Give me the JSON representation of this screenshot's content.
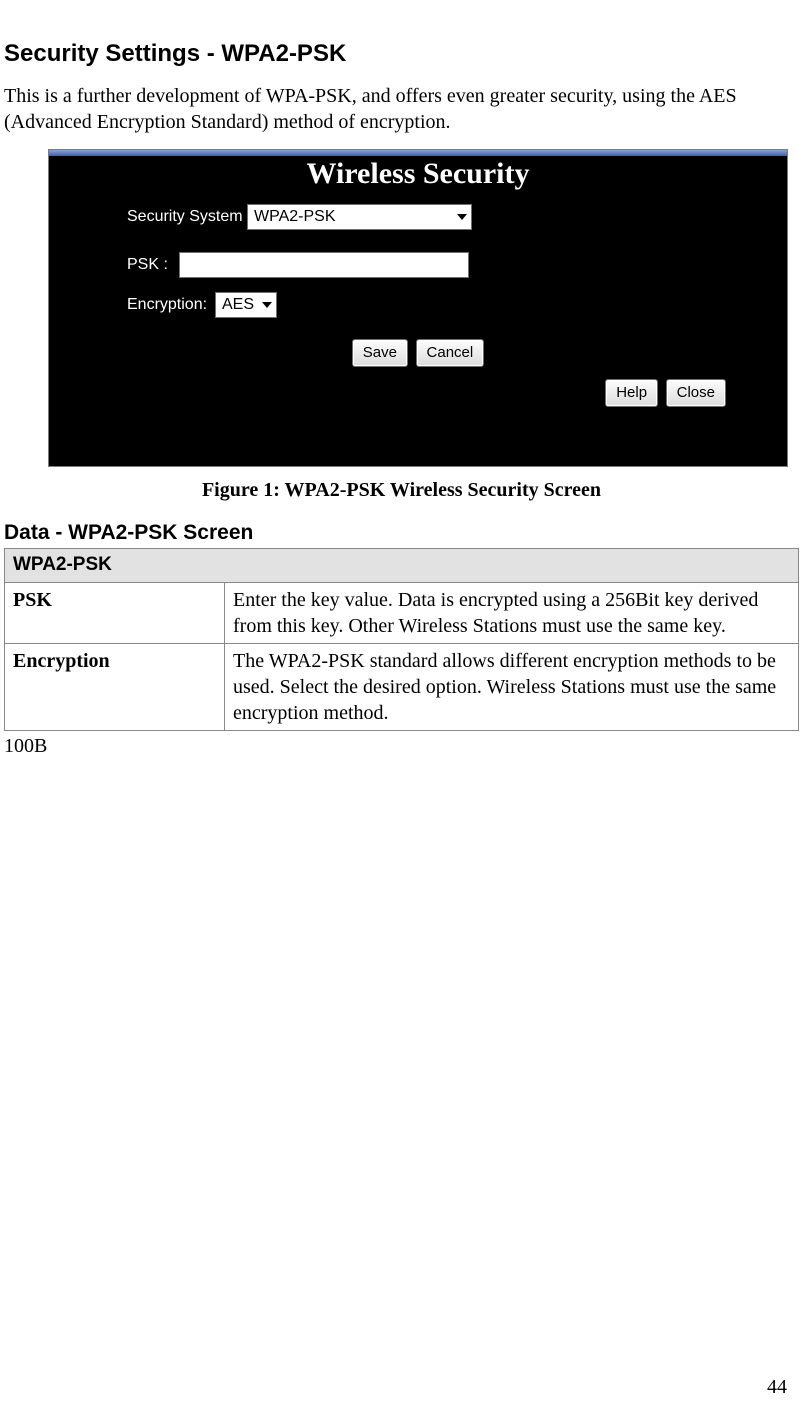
{
  "page": {
    "heading": "Security Settings - WPA2-PSK",
    "intro": "This is a further development of WPA-PSK, and offers even greater security, using the AES (Advanced Encryption Standard) method of encryption.",
    "figure_caption": "Figure 1: WPA2-PSK Wireless Security Screen",
    "subheading": "Data - WPA2-PSK Screen",
    "after_table": "100B",
    "page_number": "44"
  },
  "router": {
    "title": "Wireless Security",
    "security_system_label": "Security System",
    "security_system_value": "WPA2-PSK",
    "psk_label": "PSK :",
    "psk_value": "",
    "encryption_label": "Encryption:",
    "encryption_value": "AES",
    "buttons": {
      "save": "Save",
      "cancel": "Cancel",
      "help": "Help",
      "close": "Close"
    }
  },
  "table": {
    "header": "WPA2-PSK",
    "rows": [
      {
        "label": "PSK",
        "desc": "Enter the key value. Data is encrypted using a 256Bit key derived from this key. Other Wireless Stations must use the same key."
      },
      {
        "label": "Encryption",
        "desc": "The WPA2-PSK standard allows different encryption methods to be used. Select the desired option. Wireless Stations must use the same encryption method."
      }
    ]
  }
}
